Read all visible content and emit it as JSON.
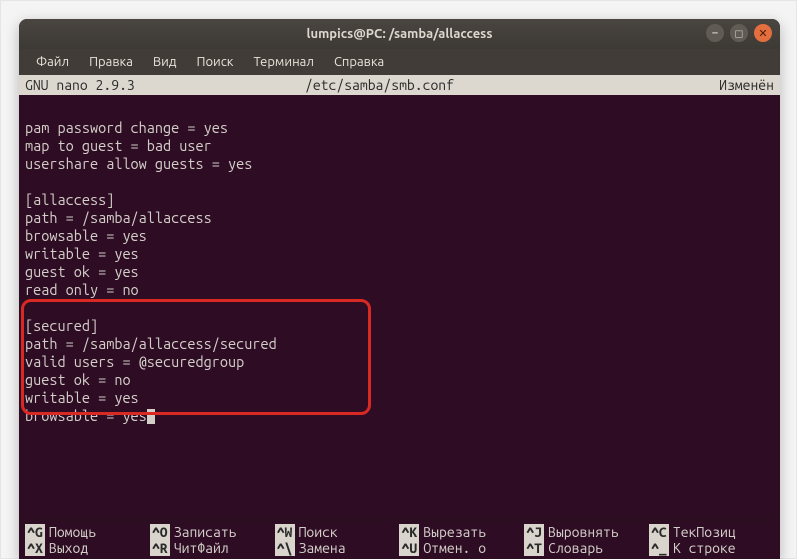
{
  "window": {
    "title": "lumpics@PC: /samba/allaccess"
  },
  "menu": {
    "file": "Файл",
    "edit": "Правка",
    "view": "Вид",
    "search": "Поиск",
    "terminal": "Терминал",
    "help": "Справка"
  },
  "nano": {
    "app": "  GNU nano 2.9.3",
    "file": "/etc/samba/smb.conf",
    "status": "Изменён"
  },
  "content": {
    "line1": "pam password change = yes",
    "line2": "map to guest = bad user",
    "line3": "usershare allow guests = yes",
    "blank1": "",
    "line4": "[allaccess]",
    "line5": "path = /samba/allaccess",
    "line6": "browsable = yes",
    "line7": "writable = yes",
    "line8": "guest ok = yes",
    "line9": "read only = no",
    "blank2": "",
    "line10": "[secured]",
    "line11": "path = /samba/allaccess/secured",
    "line12": "valid users = @securedgroup",
    "line13": "guest ok = no",
    "line14": "writable = yes",
    "line15": "browsable = yes"
  },
  "shortcuts": {
    "row1": [
      {
        "key": "^G",
        "label": "Помощь"
      },
      {
        "key": "^O",
        "label": "Записать"
      },
      {
        "key": "^W",
        "label": "Поиск"
      },
      {
        "key": "^K",
        "label": "Вырезать"
      },
      {
        "key": "^J",
        "label": "Выровнять"
      },
      {
        "key": "^C",
        "label": "ТекПозиц"
      }
    ],
    "row2": [
      {
        "key": "^X",
        "label": "Выход"
      },
      {
        "key": "^R",
        "label": "ЧитФайл"
      },
      {
        "key": "^\\",
        "label": "Замена"
      },
      {
        "key": "^U",
        "label": "Отмен. о"
      },
      {
        "key": "^T",
        "label": "Словарь"
      },
      {
        "key": "^_",
        "label": "К строке"
      }
    ]
  }
}
